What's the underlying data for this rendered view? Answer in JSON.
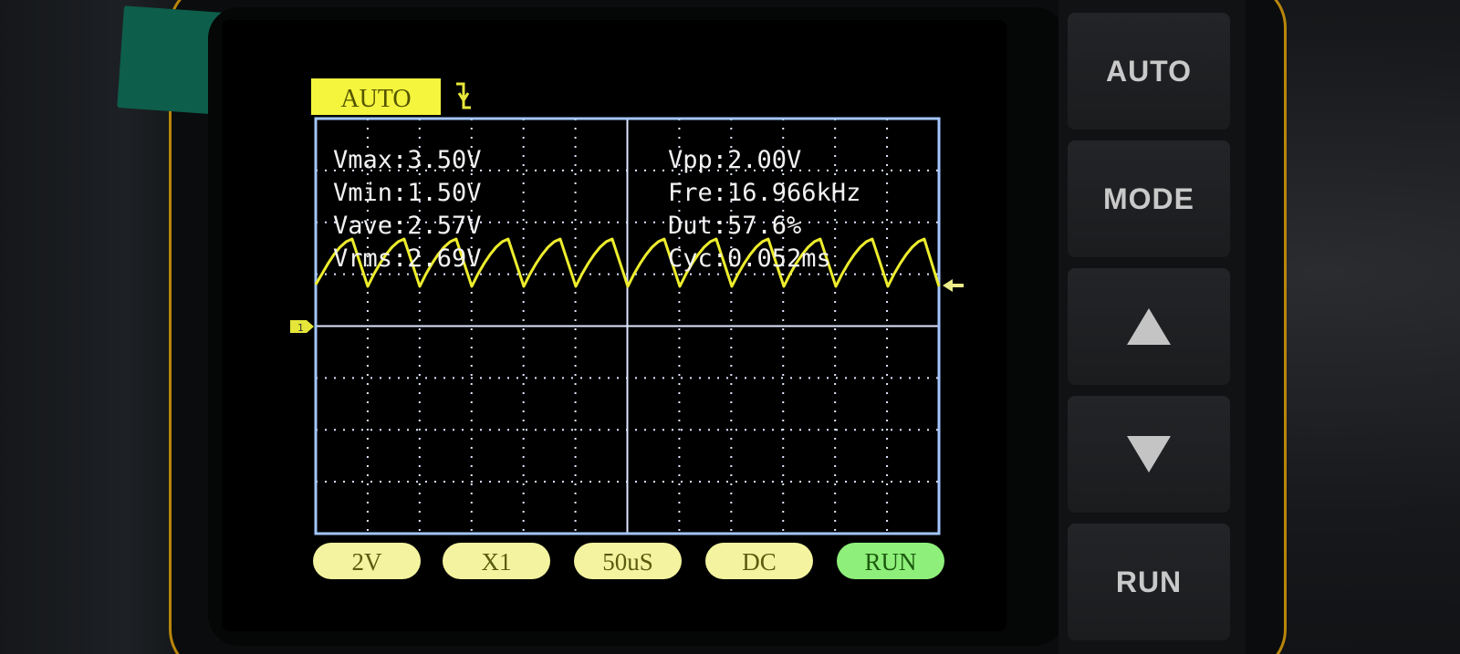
{
  "scope": {
    "trigger_mode": "AUTO",
    "trigger_edge_icon": "falling-edge-icon",
    "channel_marker": "1",
    "colors": {
      "trace": "#f2f23a",
      "grid": "#dfe6ff",
      "border": "#9bc3ff",
      "pill": "#f7f7a6",
      "run_pill": "#8ef27a",
      "text": "#f2f2f2"
    },
    "measurements": {
      "vmax": "Vmax:3.50V",
      "vmin": "Vmin:1.50V",
      "vave": "Vave:2.57V",
      "vrms": "Vrms:2.69V",
      "vpp": "Vpp:2.00V",
      "fre": "Fre:16.966kHz",
      "dut": "Dut:57.6%",
      "cyc": "Cyc:0.052ms"
    },
    "status": {
      "volts_div": "2V",
      "probe": "X1",
      "time_div": "50uS",
      "coupling": "DC",
      "run_state": "RUN"
    }
  },
  "hardware_buttons": {
    "auto": "AUTO",
    "mode": "MODE",
    "up_icon": "triangle-up-icon",
    "down_icon": "triangle-down-icon",
    "run": "RUN"
  }
}
